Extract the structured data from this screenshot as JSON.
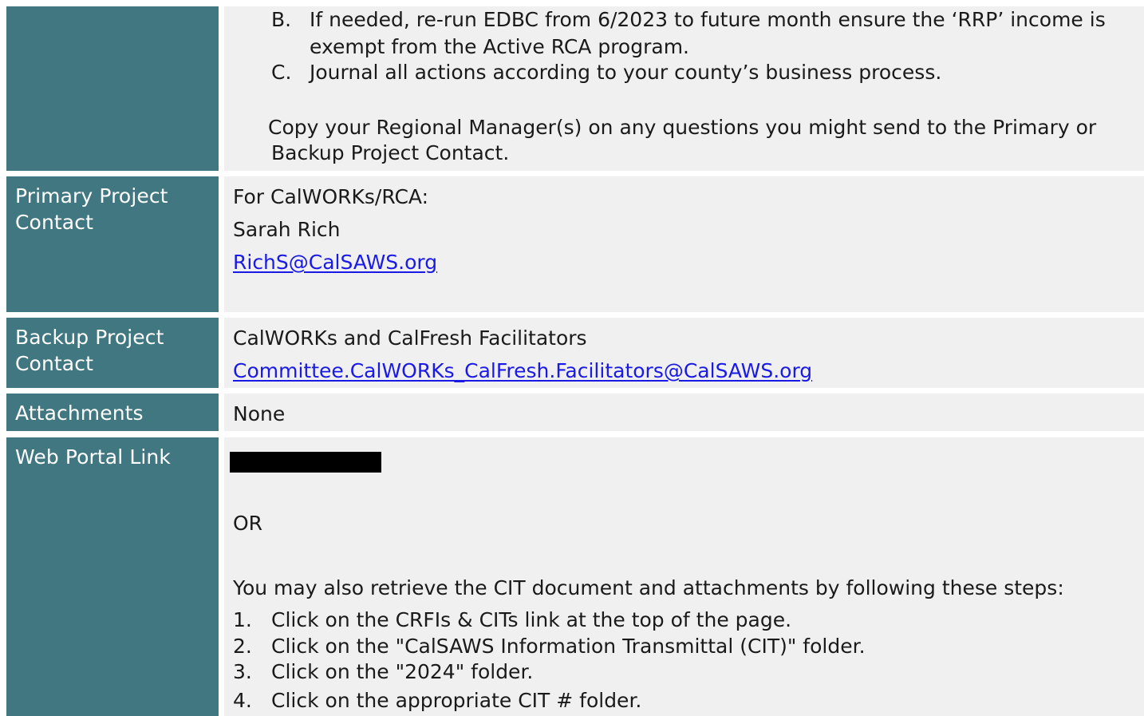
{
  "continued_section": {
    "item_b_marker": "B.",
    "item_b_line1": "If needed, re-run EDBC from 6/2023 to future month ensure the ‘RRP’ income is",
    "item_b_line2": "exempt from the Active RCA program.",
    "item_c_marker": "C.",
    "item_c_text": "Journal all actions according to your county’s business process.",
    "note_line1": "Copy your Regional Manager(s) on any questions you might send to the Primary or",
    "note_line2": "Backup Project Contact."
  },
  "primary_contact": {
    "label_line1": "Primary Project",
    "label_line2": "Contact",
    "program": "For CalWORKs/RCA:",
    "name": "Sarah Rich",
    "email": "RichS@CalSAWS.org"
  },
  "backup_contact": {
    "label_line1": "Backup Project",
    "label_line2": "Contact",
    "name": "CalWORKs and CalFresh Facilitators",
    "email": "Committee.CalWORKs_CalFresh.Facilitators@CalSAWS.org"
  },
  "attachments": {
    "label": "Attachments",
    "value": "None"
  },
  "web_portal": {
    "label": "Web Portal Link",
    "or_text": "OR",
    "intro": "You may also retrieve the CIT document and attachments by following these steps:",
    "steps": [
      {
        "num": "1.",
        "text": "Click on the CRFIs & CITs link at the top of the page."
      },
      {
        "num": "2.",
        "text": "Click on the \"CalSAWS Information Transmittal (CIT)\" folder."
      },
      {
        "num": "3.",
        "text": "Click on the \"2024\" folder."
      },
      {
        "num": "4.",
        "text": "Click on the appropriate CIT # folder."
      }
    ]
  },
  "colors": {
    "label_background": "#417780",
    "content_background": "#f0f0f0",
    "link": "#1a1ae6"
  }
}
